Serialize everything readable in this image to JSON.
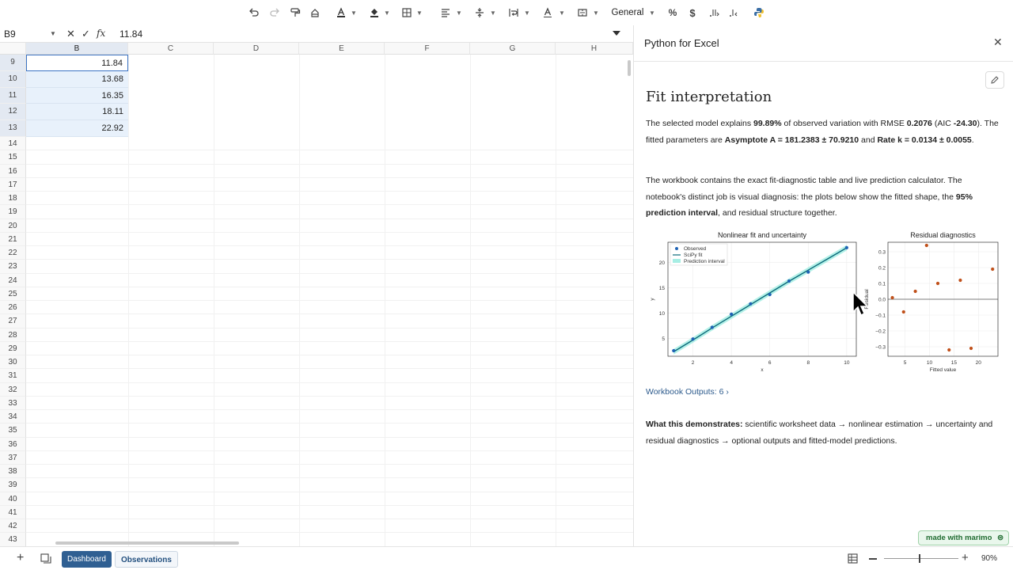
{
  "toolbar": {
    "number_format": "General"
  },
  "formula_bar": {
    "cell_ref": "B9",
    "fx": "fx",
    "value": "11.84"
  },
  "grid": {
    "columns": [
      "B",
      "C",
      "D",
      "E",
      "F",
      "G",
      "H"
    ],
    "rows": [
      {
        "num": "9",
        "value": "11.84"
      },
      {
        "num": "10",
        "value": "13.68"
      },
      {
        "num": "11",
        "value": "16.35"
      },
      {
        "num": "12",
        "value": "18.11"
      },
      {
        "num": "13",
        "value": "22.92"
      }
    ],
    "empty_rows": [
      "14",
      "15",
      "16",
      "17",
      "18",
      "19",
      "20",
      "21",
      "22",
      "23",
      "24",
      "25",
      "26",
      "27",
      "28",
      "29",
      "30",
      "31",
      "32",
      "33",
      "34",
      "35",
      "36",
      "37",
      "38",
      "39",
      "40",
      "41",
      "42",
      "43"
    ]
  },
  "sheets": {
    "tab1": "Dashboard",
    "tab2": "Observations"
  },
  "zoom": "90%",
  "panel": {
    "title": "Python for Excel",
    "heading": "Fit interpretation",
    "p1": {
      "t1": "The selected model explains ",
      "b1": "99.89%",
      "t2": " of observed variation with RMSE ",
      "b2": "0.2076",
      "t3": " (AIC ",
      "b3": "-24.30",
      "t4": "). The fitted parameters are ",
      "b4": "Asymptote A = 181.2383 ± 70.9210",
      "t5": " and ",
      "b5": "Rate k = 0.0134 ± 0.0055",
      "t6": "."
    },
    "p2": {
      "t1": "The workbook contains the exact fit-diagnostic table and live prediction calculator. The notebook's distinct job is visual diagnosis: the plots below show the fitted shape, the ",
      "b1": "95% prediction interval",
      "t2": ", and residual structure together."
    },
    "workbook_outputs": "Workbook Outputs: 6",
    "p3": {
      "b1": "What this demonstrates:",
      "t1": " scientific worksheet data → nonlinear estimation → uncertainty and residual diagnostics → optional outputs and fitted-model predictions."
    }
  },
  "chart_data": [
    {
      "type": "line",
      "title": "Nonlinear fit and uncertainty",
      "xlabel": "x",
      "ylabel": "y",
      "xlim": [
        0.7,
        10.5
      ],
      "ylim": [
        1.5,
        24.0
      ],
      "xticks": [
        "2",
        "4",
        "6",
        "8",
        "10"
      ],
      "yticks": [
        "5",
        "10",
        "15",
        "20"
      ],
      "legend": [
        "Observed",
        "SciPy fit",
        "Prediction interval"
      ],
      "legend_position": "top-left",
      "grid": true,
      "series": [
        {
          "name": "Observed",
          "x": [
            1,
            2,
            3,
            4,
            5,
            6,
            7,
            8,
            10
          ],
          "y": [
            2.6,
            4.9,
            7.2,
            9.8,
            11.84,
            13.68,
            16.35,
            18.11,
            22.92
          ]
        },
        {
          "name": "SciPy fit",
          "x": [
            1,
            2,
            3,
            4,
            5,
            6,
            7,
            8,
            9,
            10
          ],
          "y": [
            2.4,
            4.7,
            7.1,
            9.4,
            11.7,
            14.0,
            16.3,
            18.5,
            20.7,
            22.9
          ]
        }
      ],
      "band_halfwidth": 0.55
    },
    {
      "type": "scatter",
      "title": "Residual diagnostics",
      "xlabel": "Fitted value",
      "ylabel": "Residual",
      "xlim": [
        1.5,
        24.0
      ],
      "ylim": [
        -0.36,
        0.36
      ],
      "xticks": [
        "5",
        "10",
        "15",
        "20"
      ],
      "yticks": [
        "0.3",
        "0.2",
        "0.1",
        "0.0",
        "−0.1",
        "−0.2",
        "−0.3"
      ],
      "grid": true,
      "x": [
        2.4,
        4.7,
        7.1,
        9.4,
        11.7,
        14.0,
        16.3,
        18.5,
        22.9
      ],
      "y": [
        0.01,
        -0.08,
        0.05,
        0.34,
        0.1,
        -0.32,
        0.12,
        -0.31,
        0.19
      ]
    }
  ]
}
